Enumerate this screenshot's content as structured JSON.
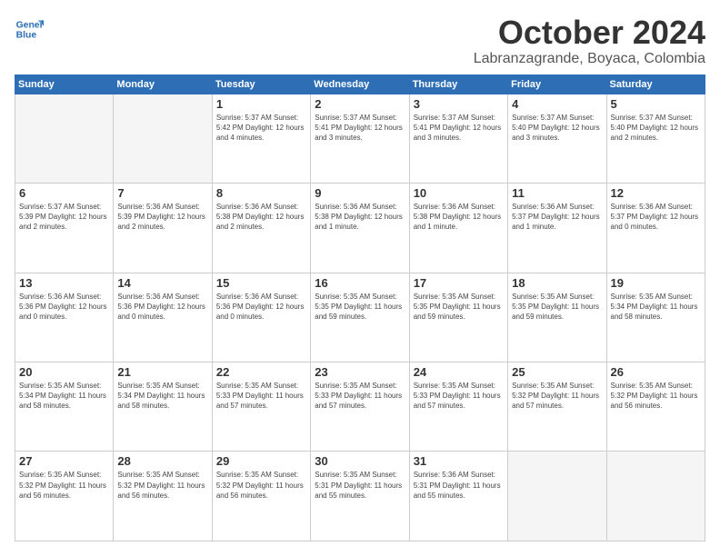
{
  "logo": {
    "line1": "General",
    "line2": "Blue"
  },
  "title": "October 2024",
  "subtitle": "Labranzagrande, Boyaca, Colombia",
  "headers": [
    "Sunday",
    "Monday",
    "Tuesday",
    "Wednesday",
    "Thursday",
    "Friday",
    "Saturday"
  ],
  "weeks": [
    [
      {
        "day": "",
        "info": ""
      },
      {
        "day": "",
        "info": ""
      },
      {
        "day": "1",
        "info": "Sunrise: 5:37 AM\nSunset: 5:42 PM\nDaylight: 12 hours\nand 4 minutes."
      },
      {
        "day": "2",
        "info": "Sunrise: 5:37 AM\nSunset: 5:41 PM\nDaylight: 12 hours\nand 3 minutes."
      },
      {
        "day": "3",
        "info": "Sunrise: 5:37 AM\nSunset: 5:41 PM\nDaylight: 12 hours\nand 3 minutes."
      },
      {
        "day": "4",
        "info": "Sunrise: 5:37 AM\nSunset: 5:40 PM\nDaylight: 12 hours\nand 3 minutes."
      },
      {
        "day": "5",
        "info": "Sunrise: 5:37 AM\nSunset: 5:40 PM\nDaylight: 12 hours\nand 2 minutes."
      }
    ],
    [
      {
        "day": "6",
        "info": "Sunrise: 5:37 AM\nSunset: 5:39 PM\nDaylight: 12 hours\nand 2 minutes."
      },
      {
        "day": "7",
        "info": "Sunrise: 5:36 AM\nSunset: 5:39 PM\nDaylight: 12 hours\nand 2 minutes."
      },
      {
        "day": "8",
        "info": "Sunrise: 5:36 AM\nSunset: 5:38 PM\nDaylight: 12 hours\nand 2 minutes."
      },
      {
        "day": "9",
        "info": "Sunrise: 5:36 AM\nSunset: 5:38 PM\nDaylight: 12 hours\nand 1 minute."
      },
      {
        "day": "10",
        "info": "Sunrise: 5:36 AM\nSunset: 5:38 PM\nDaylight: 12 hours\nand 1 minute."
      },
      {
        "day": "11",
        "info": "Sunrise: 5:36 AM\nSunset: 5:37 PM\nDaylight: 12 hours\nand 1 minute."
      },
      {
        "day": "12",
        "info": "Sunrise: 5:36 AM\nSunset: 5:37 PM\nDaylight: 12 hours\nand 0 minutes."
      }
    ],
    [
      {
        "day": "13",
        "info": "Sunrise: 5:36 AM\nSunset: 5:36 PM\nDaylight: 12 hours\nand 0 minutes."
      },
      {
        "day": "14",
        "info": "Sunrise: 5:36 AM\nSunset: 5:36 PM\nDaylight: 12 hours\nand 0 minutes."
      },
      {
        "day": "15",
        "info": "Sunrise: 5:36 AM\nSunset: 5:36 PM\nDaylight: 12 hours\nand 0 minutes."
      },
      {
        "day": "16",
        "info": "Sunrise: 5:35 AM\nSunset: 5:35 PM\nDaylight: 11 hours\nand 59 minutes."
      },
      {
        "day": "17",
        "info": "Sunrise: 5:35 AM\nSunset: 5:35 PM\nDaylight: 11 hours\nand 59 minutes."
      },
      {
        "day": "18",
        "info": "Sunrise: 5:35 AM\nSunset: 5:35 PM\nDaylight: 11 hours\nand 59 minutes."
      },
      {
        "day": "19",
        "info": "Sunrise: 5:35 AM\nSunset: 5:34 PM\nDaylight: 11 hours\nand 58 minutes."
      }
    ],
    [
      {
        "day": "20",
        "info": "Sunrise: 5:35 AM\nSunset: 5:34 PM\nDaylight: 11 hours\nand 58 minutes."
      },
      {
        "day": "21",
        "info": "Sunrise: 5:35 AM\nSunset: 5:34 PM\nDaylight: 11 hours\nand 58 minutes."
      },
      {
        "day": "22",
        "info": "Sunrise: 5:35 AM\nSunset: 5:33 PM\nDaylight: 11 hours\nand 57 minutes."
      },
      {
        "day": "23",
        "info": "Sunrise: 5:35 AM\nSunset: 5:33 PM\nDaylight: 11 hours\nand 57 minutes."
      },
      {
        "day": "24",
        "info": "Sunrise: 5:35 AM\nSunset: 5:33 PM\nDaylight: 11 hours\nand 57 minutes."
      },
      {
        "day": "25",
        "info": "Sunrise: 5:35 AM\nSunset: 5:32 PM\nDaylight: 11 hours\nand 57 minutes."
      },
      {
        "day": "26",
        "info": "Sunrise: 5:35 AM\nSunset: 5:32 PM\nDaylight: 11 hours\nand 56 minutes."
      }
    ],
    [
      {
        "day": "27",
        "info": "Sunrise: 5:35 AM\nSunset: 5:32 PM\nDaylight: 11 hours\nand 56 minutes."
      },
      {
        "day": "28",
        "info": "Sunrise: 5:35 AM\nSunset: 5:32 PM\nDaylight: 11 hours\nand 56 minutes."
      },
      {
        "day": "29",
        "info": "Sunrise: 5:35 AM\nSunset: 5:32 PM\nDaylight: 11 hours\nand 56 minutes."
      },
      {
        "day": "30",
        "info": "Sunrise: 5:35 AM\nSunset: 5:31 PM\nDaylight: 11 hours\nand 55 minutes."
      },
      {
        "day": "31",
        "info": "Sunrise: 5:36 AM\nSunset: 5:31 PM\nDaylight: 11 hours\nand 55 minutes."
      },
      {
        "day": "",
        "info": ""
      },
      {
        "day": "",
        "info": ""
      }
    ]
  ]
}
